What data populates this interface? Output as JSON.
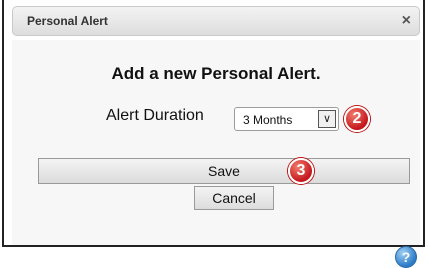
{
  "dialog": {
    "title": "Personal Alert",
    "close_glyph": "×",
    "heading": "Add a new Personal Alert."
  },
  "duration": {
    "label": "Alert Duration",
    "selected": "3 Months",
    "arrow_glyph": "∨"
  },
  "badges": {
    "two": "2",
    "three": "3"
  },
  "buttons": {
    "save": "Save",
    "cancel": "Cancel"
  },
  "help": {
    "glyph": "?",
    "icon": "help-icon"
  },
  "colors": {
    "badge": "#c4161c",
    "help": "#2a7bc8"
  }
}
